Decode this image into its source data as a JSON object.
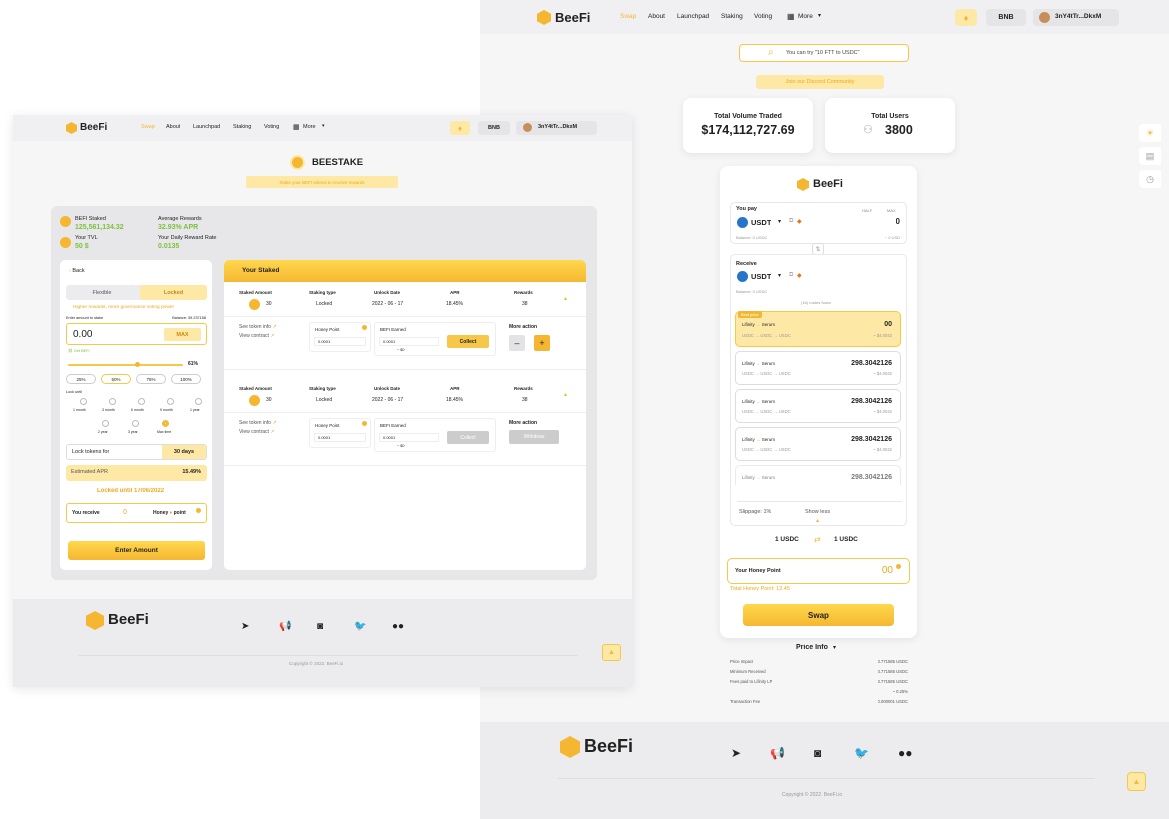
{
  "colors": {
    "accent": "#f5b731",
    "green": "#7cc13e",
    "orange": "#f0a81d"
  },
  "nav": {
    "logo": "BeeFi",
    "items": [
      "Swap",
      "About",
      "Launchpad",
      "Staking",
      "Voting"
    ],
    "more": "More",
    "network": "BNB",
    "wallet": "3nY4tTr...DkxM",
    "icons": {
      "theme": "bee-icon",
      "more": "grid-icon",
      "chevron": "chevron-down-icon"
    }
  },
  "stake": {
    "title": "BEESTAKE",
    "banner": "Stake your BEFI tokens to receive rewards",
    "summary": {
      "staked_label": "BEFI Staked",
      "staked_value": "125,561,134.32",
      "avg_label": "Average Rewards",
      "avg_value": "32.93% APR",
      "tvl_label": "Your TVL",
      "tvl_value": "50 $",
      "daily_label": "Your Daily Reward Rate",
      "daily_value": "0.0135"
    },
    "form": {
      "back": "Back",
      "tab_flexible": "Flexible",
      "tab_locked": "Locked",
      "hint": "Higher rewards, more governance voting power",
      "enter_label": "Enter amount to stake",
      "balance": "Balance: 39.237158",
      "amount": "0.00",
      "max": "MAX",
      "get_befi": "Get BEFI",
      "slider_pct": "61%",
      "slider_fraction": 0.61,
      "pcts": [
        "25%",
        "50%",
        "75%",
        "100%"
      ],
      "lock_until": "Lock until",
      "periods_row1": [
        "1 month",
        "3 month",
        "6 month",
        "9 month",
        "1 year"
      ],
      "periods_row2": [
        "2 year",
        "3 year",
        "Max time"
      ],
      "lock_label": "Lock tokens for",
      "lock_value": "30 days",
      "apr_label": "Estimated APR",
      "apr_value": "15.49%",
      "locked_until": "Locked until 17/06/2022",
      "receive": "You receive",
      "receive_value": "0",
      "honey": "Honey",
      "point": "point",
      "enter_btn": "Enter Amount"
    },
    "staked": {
      "title": "Your Staked",
      "headers": [
        "Staked Amount",
        "Staking type",
        "Unlock Date",
        "APR",
        "Rewards"
      ],
      "rows": [
        {
          "amount": "30",
          "type": "Locked",
          "date": "2022 - 06 - 17",
          "apr": "18.45%",
          "rewards": "38",
          "see": "See token info",
          "view": "View contract",
          "hp_label": "Honey Point",
          "hp_value": "0.0001",
          "earned_label": "BEFI Earned",
          "earned_value": "0.0001",
          "earned_usd": "~ $0",
          "collect": "Collect",
          "more": "More action",
          "minus": "–",
          "plus": "+"
        },
        {
          "amount": "30",
          "type": "Locked",
          "date": "2022 - 06 - 17",
          "apr": "18.45%",
          "rewards": "38",
          "see": "See token info",
          "view": "View contract",
          "hp_label": "Honey Point",
          "hp_value": "0.0001",
          "earned_label": "BEFI Earned",
          "earned_value": "0.0001",
          "earned_usd": "~ $0",
          "collect": "Collect",
          "more": "More action",
          "withdraw": "Withdraw"
        }
      ]
    }
  },
  "footer": {
    "logo": "BeeFi",
    "copyright": "Copyright © 2022. BeeFi.io",
    "socials": [
      "telegram-icon",
      "megaphone-icon",
      "discord-icon",
      "twitter-icon",
      "medium-icon"
    ]
  },
  "swap": {
    "search_placeholder": "You can try \"10 FTT to USDC\"",
    "discord": "Join our Discord Community",
    "volume_label": "Total Volume Traded",
    "volume_value": "$174,112,727.69",
    "users_label": "Total Users",
    "users_value": "3800",
    "logo": "BeeFi",
    "pay_label": "You pay",
    "half": "HALF",
    "max": "MAX",
    "pay_token": "USDT",
    "pay_amount": "0",
    "pay_balance": "Balance: 0 USDC",
    "pay_usd": "~ 0 USD",
    "receive_label": "Receive",
    "receive_token": "USDT",
    "receive_balance": "Balance: 0 USDC",
    "routes_found": "(16) routes found",
    "best": "Best price",
    "routes": [
      {
        "from": "Lifinity",
        "to": "Serum",
        "path": "USDC → USDC → USDC",
        "value": "00",
        "usd": "~ $4.0042"
      },
      {
        "from": "Lifinity",
        "to": "Serum",
        "path": "USDC → USDC → USDC",
        "value": "298.3042126",
        "usd": "~ $4.0042"
      },
      {
        "from": "Lifinity",
        "to": "Serum",
        "path": "USDC → USDC → USDC",
        "value": "298.3042126",
        "usd": "~ $4.0042"
      },
      {
        "from": "Lifinity",
        "to": "Serum",
        "path": "USDC → USDC → USDC",
        "value": "298.3042126",
        "usd": "~ $4.0042"
      },
      {
        "from": "Lifinity",
        "to": "Serum",
        "path": "",
        "value": "298.3042126",
        "usd": ""
      }
    ],
    "slippage": "Slippage: 1%",
    "show_less": "Show less",
    "rate_left": "1 USDC",
    "rate_right": "1 USDC",
    "honey_label": "Your Honey Point",
    "honey_value": "00",
    "total_honey": "Total Honey Point: 12.45",
    "swap_btn": "Swap",
    "price_info": "Price Info",
    "info": [
      {
        "k": "Price Impact",
        "v": "3.771585 USDC"
      },
      {
        "k": "Minimum Received",
        "v": "3.771585 USDC"
      },
      {
        "k": "Fees paid to Lifinity LP",
        "v": "3.771585 USDC"
      },
      {
        "k": "",
        "v": "~ 0.25%"
      },
      {
        "k": "Transaction Fee",
        "v": "0.000001 USDC"
      }
    ]
  }
}
